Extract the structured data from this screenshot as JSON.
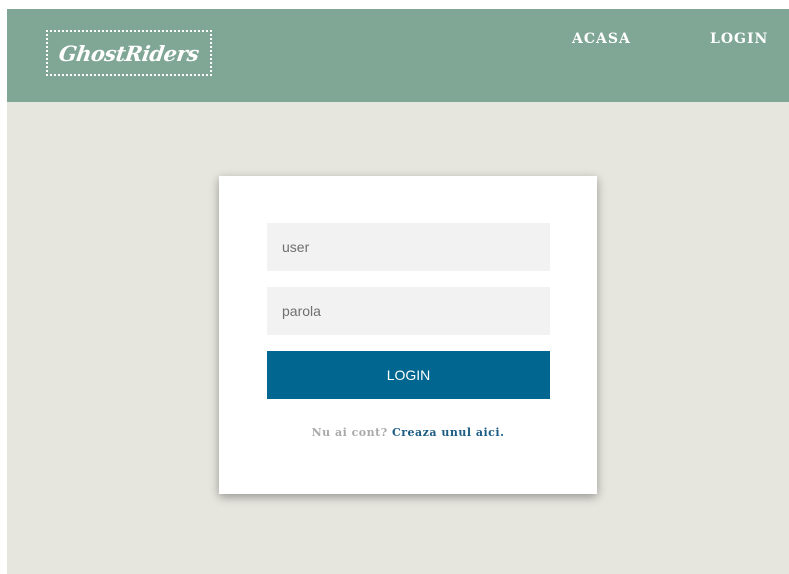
{
  "header": {
    "logo_text": "GhostRiders",
    "nav": {
      "home_label": "ACASA",
      "login_label": "LOGIN"
    }
  },
  "login_form": {
    "user_placeholder": "user",
    "password_placeholder": "parola",
    "submit_label": "LOGIN",
    "register_prompt": "Nu ai cont?",
    "register_link": "Creaza unul aici."
  },
  "colors": {
    "header_bg": "#80a796",
    "page_bg": "#e6e5de",
    "button_bg": "#016690",
    "link": "#1d5c84"
  }
}
